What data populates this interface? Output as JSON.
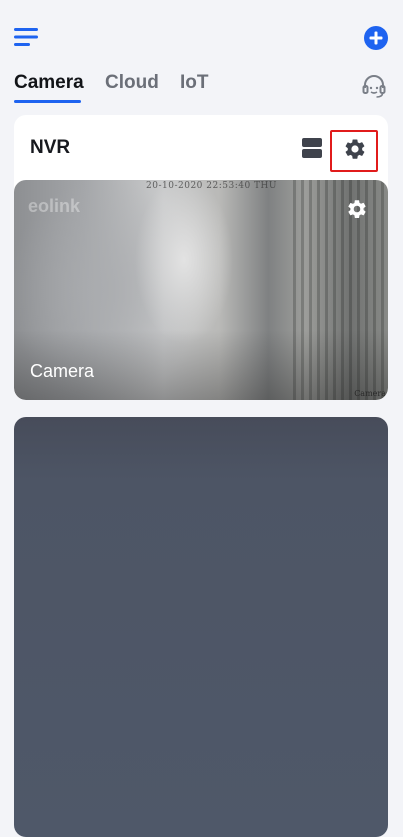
{
  "header": {
    "menu_icon": "hamburger-menu-icon",
    "add_icon": "plus-circle-icon",
    "support_icon": "headset-support-icon",
    "accent_color": "#1e63f0"
  },
  "tabs": [
    {
      "label": "Camera",
      "active": true
    },
    {
      "label": "Cloud",
      "active": false
    },
    {
      "label": "IoT",
      "active": false
    }
  ],
  "device": {
    "name": "NVR",
    "highlight_color": "#e11b1b",
    "camera": {
      "name": "Camera",
      "osd_timestamp": "20-10-2020 22:53:40 THU",
      "watermark": "eolink",
      "osd_name": "Camera"
    }
  }
}
